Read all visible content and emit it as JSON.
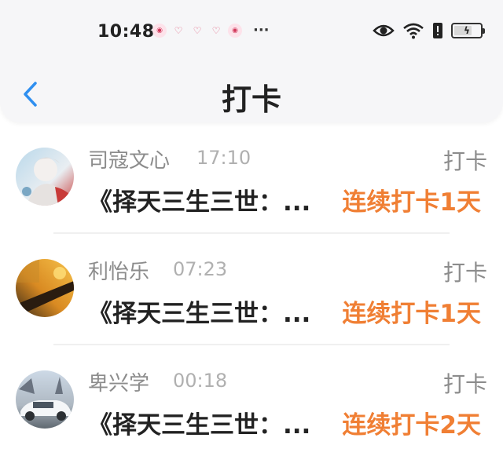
{
  "status_bar": {
    "time": "10:48",
    "more": "···"
  },
  "title_bar": {
    "title": "打卡"
  },
  "items": [
    {
      "name": "司寇文心",
      "time": "17:10",
      "type": "打卡",
      "content": "《择天三生三世：...",
      "highlight": "连续打卡1天"
    },
    {
      "name": "利怡乐",
      "time": "07:23",
      "type": "打卡",
      "content": "《择天三生三世：...",
      "highlight": "连续打卡1天"
    },
    {
      "name": "卑兴学",
      "time": "00:18",
      "type": "打卡",
      "content": "《择天三生三世：...",
      "highlight": "连续打卡2天"
    }
  ],
  "colors": {
    "accent": "#f07f34",
    "back_arrow": "#2f8ff0",
    "header_bg": "#f6f6f8"
  },
  "icons": {
    "back": "chevron-left-icon",
    "eye": "eye-icon",
    "wifi": "wifi-icon",
    "sim": "sim-card-icon",
    "battery": "battery-charging-icon"
  }
}
